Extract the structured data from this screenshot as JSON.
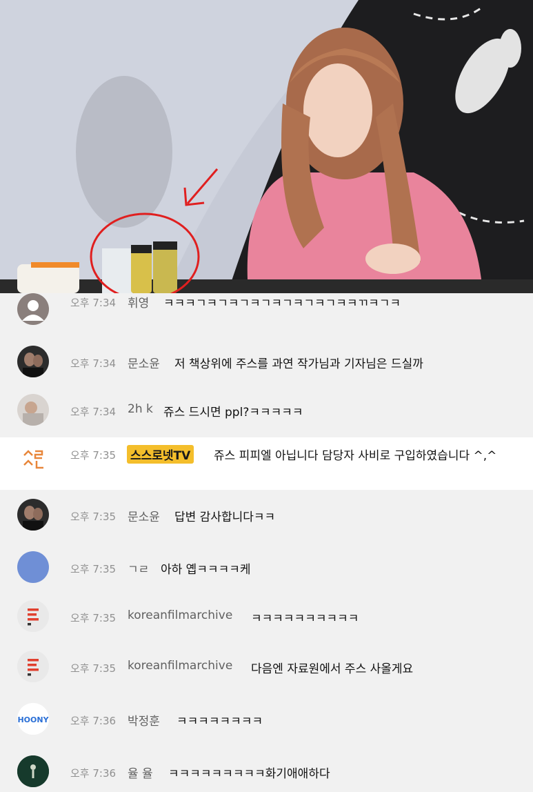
{
  "video": {
    "overlay_annotation": "circle-and-arrow",
    "colors": {
      "annotation": "#e01f1f",
      "shirt": "#e9849c",
      "backdrop": "#1d1d1f"
    }
  },
  "chat": {
    "messages": [
      {
        "time": "오후 7:34",
        "author": "휘영",
        "text": "ㅋㅋㅋㄱㅋㄱㅋㄱㅋㄱㅋㄱㅋㄱㅋㄱㅋㅋㄲㅋㄱㅋ",
        "avatar": "user-icon"
      },
      {
        "time": "오후 7:34",
        "author": "문소윤",
        "text": "저 책상위에 주스를 과연 작가님과 기자님은 드실까",
        "avatar": "photo-avatar"
      },
      {
        "time": "오후 7:34",
        "author": "2h k",
        "text": "쥬스 드시면 ppl?ㅋㅋㅋㅋㅋ",
        "avatar": "photo-avatar"
      },
      {
        "time": "오후 7:35",
        "author": "스스로넷TV",
        "text": "쥬스 피피엘 아닙니다 담당자 사비로 구입하였습니다 ^,^",
        "avatar": "channel-logo",
        "pinned": true
      },
      {
        "time": "오후 7:35",
        "author": "문소윤",
        "text": "답변 감사합니다ㅋㅋ",
        "avatar": "photo-avatar"
      },
      {
        "time": "오후 7:35",
        "author": "ㄱㄹ",
        "text": "아하 옙ㅋㅋㅋㅋ케",
        "avatar": "blue-circle"
      },
      {
        "time": "오후 7:35",
        "author": "koreanfilmarchive",
        "text": "ㅋㅋㅋㅋㅋㅋㅋㅋㅋㅋ",
        "avatar": "archive-logo"
      },
      {
        "time": "오후 7:35",
        "author": "koreanfilmarchive",
        "text": "다음엔 자료원에서 주스 사올게요",
        "avatar": "archive-logo"
      },
      {
        "time": "오후 7:36",
        "author": "박정훈",
        "text": "ㅋㅋㅋㅋㅋㅋㅋㅋ",
        "avatar": "hoony-logo"
      },
      {
        "time": "오후 7:36",
        "author": "율 율",
        "text": "ㅋㅋㅋㅋㅋㅋㅋㅋㅋ화기애애하다",
        "avatar": "dark-green-logo"
      }
    ],
    "hoony_logo_text": "HOONY",
    "channel_logo_text": "스ㄹ\nㅅㄴ",
    "colors": {
      "badge_bg": "#f4be2b",
      "timestamp": "#909090",
      "author": "#606060",
      "text": "#111111",
      "pinned_bg": "#ffffff",
      "list_bg": "#f1f1f1"
    }
  }
}
